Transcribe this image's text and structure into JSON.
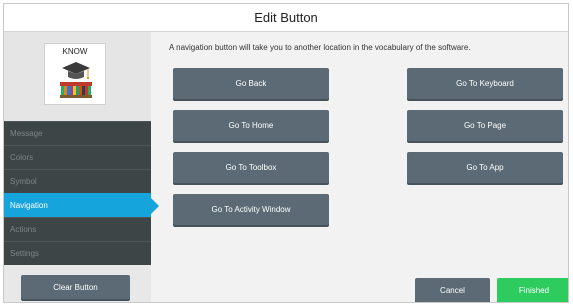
{
  "dialog": {
    "title": "Edit Button"
  },
  "preview": {
    "label": "KNOW",
    "symbol_icon": "graduation-cap-books-icon"
  },
  "sidebar": {
    "menu": [
      {
        "label": "Message",
        "active": false
      },
      {
        "label": "Colors",
        "active": false
      },
      {
        "label": "Symbol",
        "active": false
      },
      {
        "label": "Navigation",
        "active": true
      },
      {
        "label": "Actions",
        "active": false
      },
      {
        "label": "Settings",
        "active": false
      }
    ],
    "clear_button": "Clear Button"
  },
  "navigation": {
    "instructions": "A navigation button will take you to another location in the vocabulary of the software.",
    "buttons": {
      "go_back": "Go Back",
      "go_to_keyboard": "Go To Keyboard",
      "go_to_home": "Go To Home",
      "go_to_page": "Go To Page",
      "go_to_toolbox": "Go To Toolbox",
      "go_to_app": "Go To App",
      "go_to_activity_window": "Go To Activity Window"
    }
  },
  "footer": {
    "cancel": "Cancel",
    "finished": "Finished"
  },
  "colors": {
    "active_tab": "#16a4dc",
    "menu_bg": "#3e4547",
    "button_gray": "#5b6a74",
    "finished_green": "#2ecc5e"
  }
}
